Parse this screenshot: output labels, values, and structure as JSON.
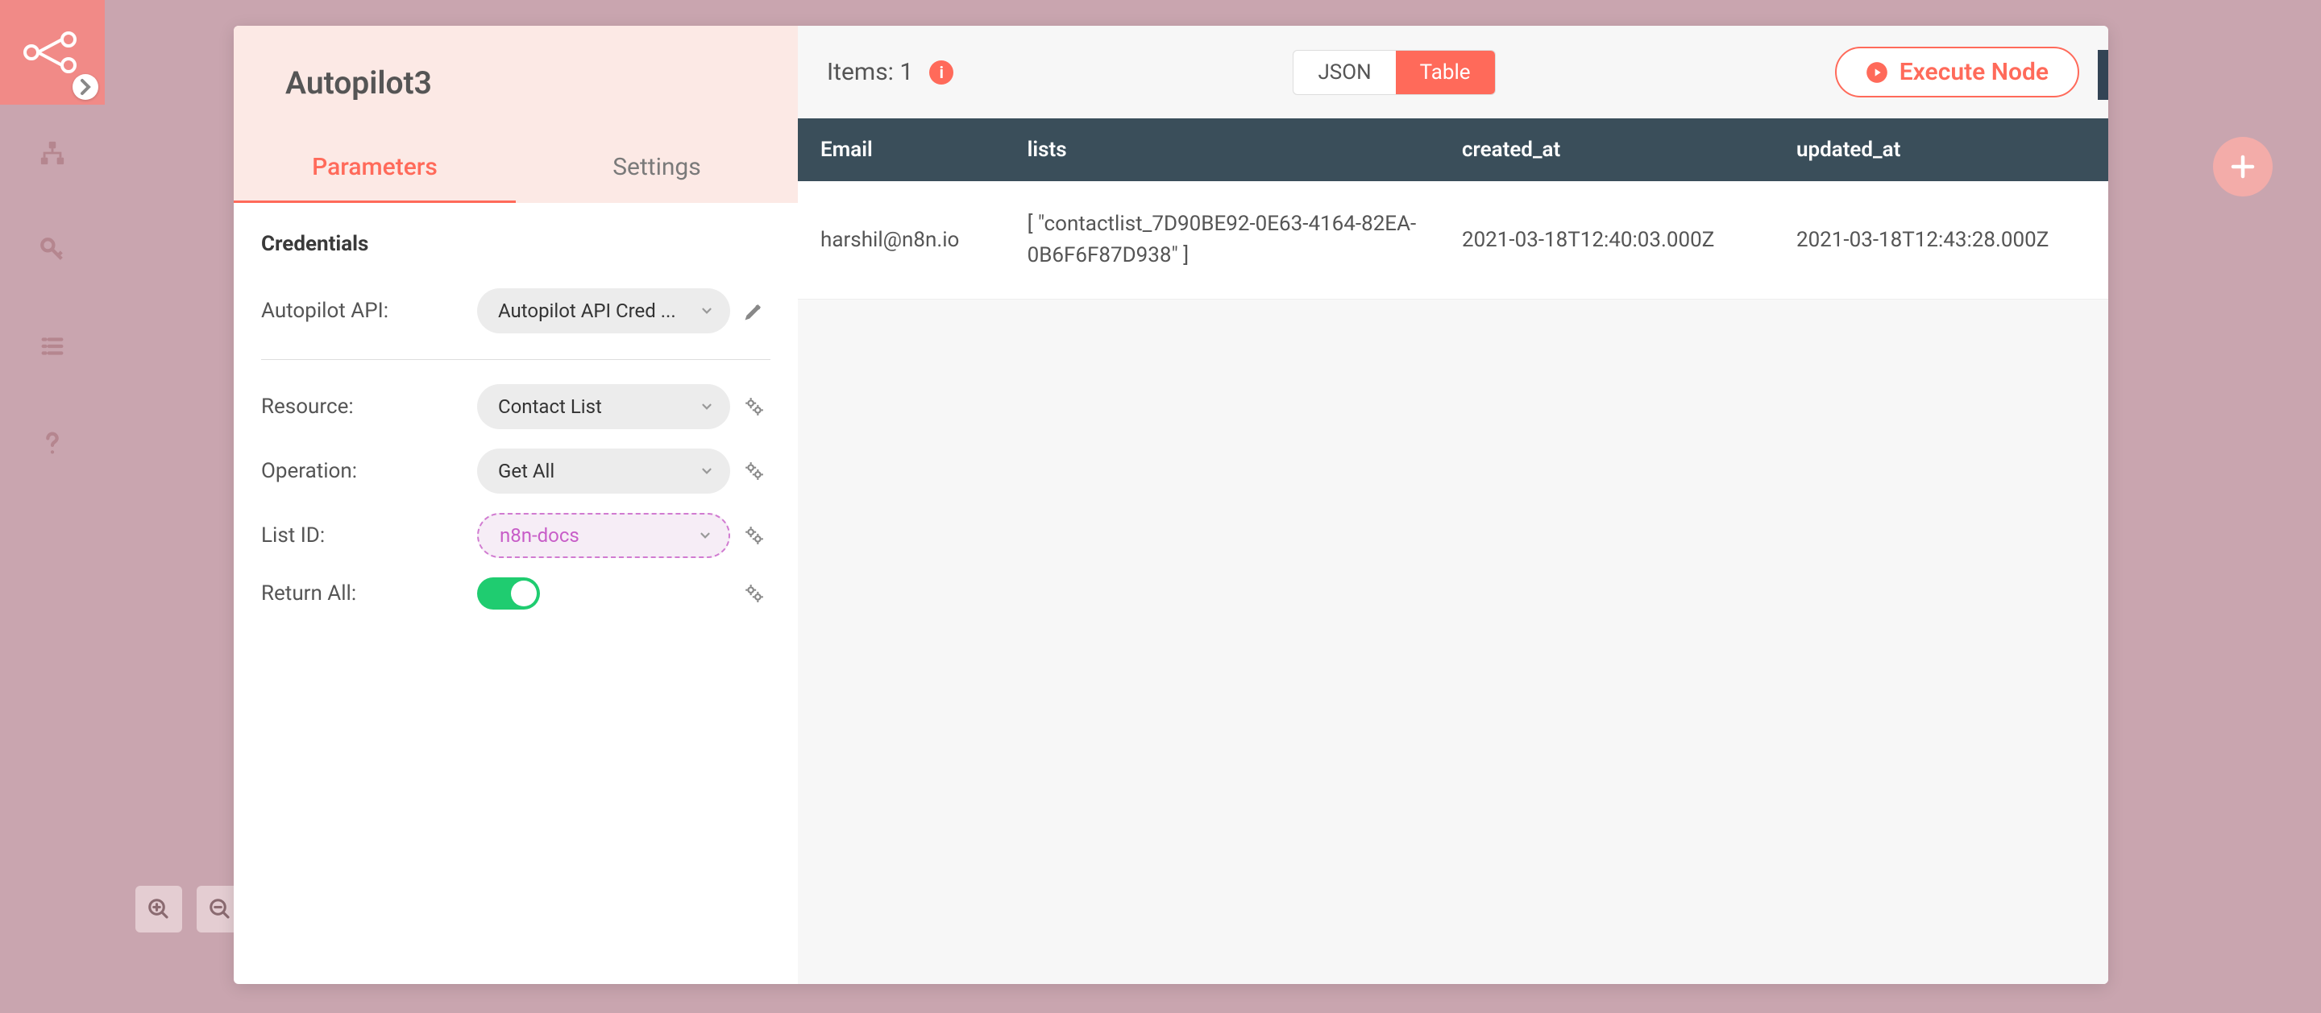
{
  "sidebar": {
    "items": [
      "workflows-icon",
      "share-icon",
      "credentials-icon",
      "executions-icon",
      "help-icon"
    ]
  },
  "modal": {
    "title": "Autopilot3",
    "tabs": {
      "parameters": "Parameters",
      "settings": "Settings",
      "activeIndex": 0
    }
  },
  "params": {
    "credentials_title": "Credentials",
    "credential_label": "Autopilot API:",
    "credential_value": "Autopilot API Cred ...",
    "resource_label": "Resource:",
    "resource_value": "Contact List",
    "operation_label": "Operation:",
    "operation_value": "Get All",
    "listid_label": "List ID:",
    "listid_value": "n8n-docs",
    "returnall_label": "Return All:"
  },
  "output": {
    "items_label": "Items:",
    "items_count": "1",
    "view_json": "JSON",
    "view_table": "Table",
    "execute_label": "Execute Node",
    "columns": [
      "Email",
      "lists",
      "created_at",
      "updated_at"
    ],
    "rows": [
      {
        "email": "harshil@n8n.io",
        "lists": "[ \"contactlist_7D90BE92-0E63-4164-82EA-0B6F6F87D938\" ]",
        "created_at": "2021-03-18T12:40:03.000Z",
        "updated_at": "2021-03-18T12:43:28.000Z"
      }
    ]
  }
}
